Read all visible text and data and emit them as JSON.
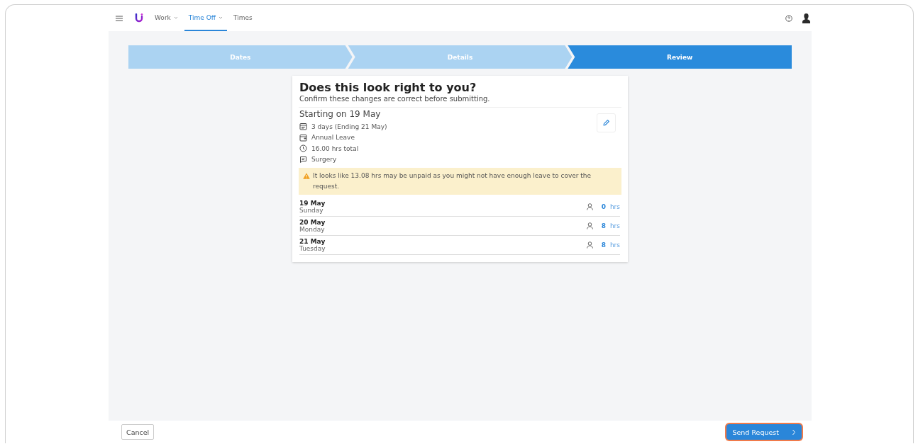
{
  "nav": {
    "items": [
      {
        "label": "Work",
        "dropdown": true,
        "selected": false
      },
      {
        "label": "Time Off",
        "dropdown": true,
        "selected": true
      },
      {
        "label": "Times",
        "dropdown": false,
        "selected": false
      }
    ]
  },
  "steps": [
    {
      "label": "Dates",
      "selected": false
    },
    {
      "label": "Details",
      "selected": false
    },
    {
      "label": "Review",
      "selected": true
    }
  ],
  "card": {
    "title": "Does this look right to you?",
    "subtitle": "Confirm these changes are correct before submitting.",
    "start": "Starting on 19 May",
    "details": [
      {
        "kind": "calendar",
        "text": "3 days (Ending 21 May)"
      },
      {
        "kind": "leave",
        "text": "Annual Leave"
      },
      {
        "kind": "clock",
        "text": "16.00 hrs total"
      },
      {
        "kind": "comment",
        "text": "Surgery"
      }
    ],
    "warning": "It looks like 13.08 hrs may be unpaid as you might not have enough leave to cover the request.",
    "days": [
      {
        "date": "19 May",
        "weekday": "Sunday",
        "hours": "0",
        "unit": "hrs"
      },
      {
        "date": "20 May",
        "weekday": "Monday",
        "hours": "8",
        "unit": "hrs"
      },
      {
        "date": "21 May",
        "weekday": "Tuesday",
        "hours": "8",
        "unit": "hrs"
      }
    ]
  },
  "footer": {
    "cancel": "Cancel",
    "submit": "Send Request"
  }
}
